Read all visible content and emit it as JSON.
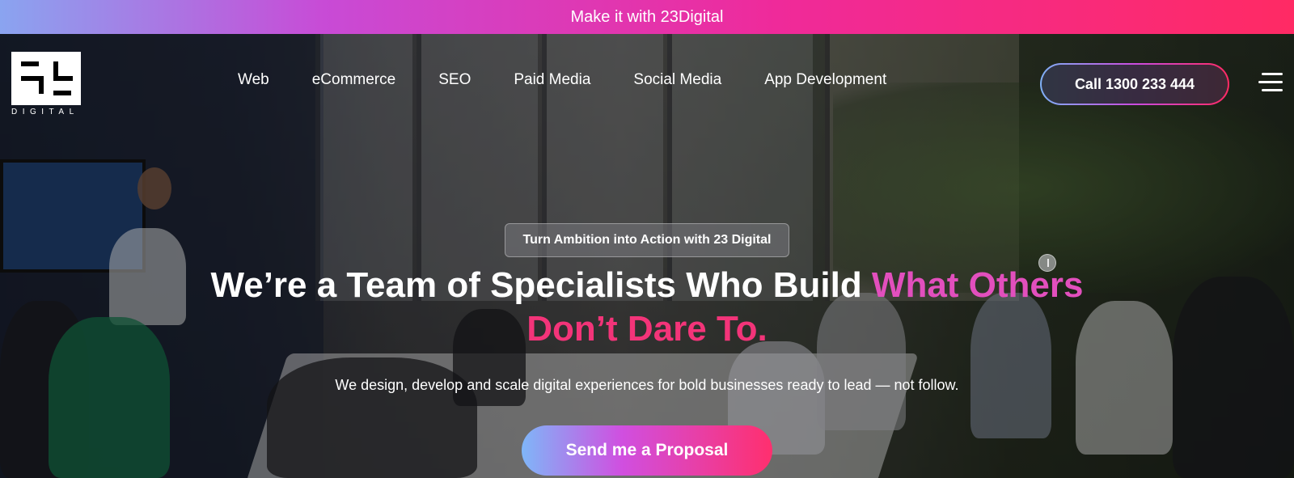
{
  "promo": {
    "text": "Make it with 23Digital"
  },
  "logo": {
    "mark": "23",
    "word": "DIGITAL"
  },
  "nav": {
    "items": [
      "Web",
      "eCommerce",
      "SEO",
      "Paid Media",
      "Social Media",
      "App Development"
    ]
  },
  "header": {
    "call_label": "Call 1300 233 444",
    "menu_icon": "hamburger-icon"
  },
  "hero": {
    "badge": "Turn Ambition into Action with 23 Digital",
    "headline_white": "We’re a Team of Specialists Who Build ",
    "headline_pink1": "What Others",
    "headline_pink2": "Don’t Dare To.",
    "subtext": "We design, develop and scale digital experiences for bold businesses ready to lead — not follow.",
    "cta_label": "Send me a Proposal"
  },
  "colors": {
    "accent_pink": "#f33479",
    "accent_magenta": "#e24fbd",
    "accent_blue": "#7fb0f5"
  }
}
